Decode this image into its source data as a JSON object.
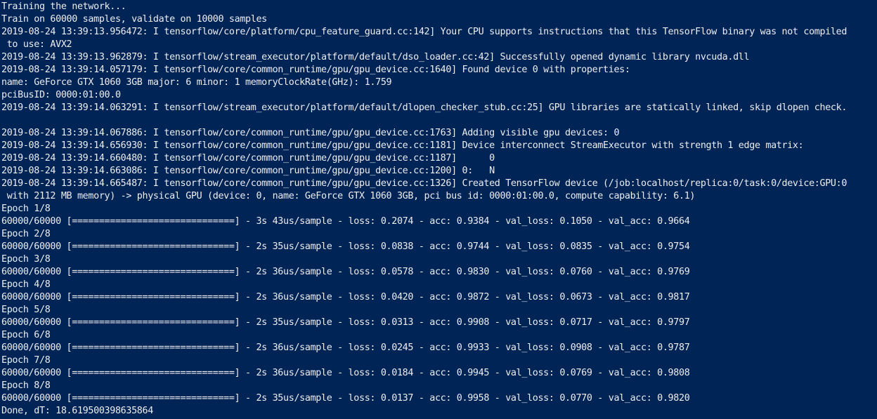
{
  "console": {
    "background_color": "#012456",
    "text_color": "#eeedf0",
    "lines": [
      "Training the network...",
      "Train on 60000 samples, validate on 10000 samples",
      "2019-08-24 13:39:13.956472: I tensorflow/core/platform/cpu_feature_guard.cc:142] Your CPU supports instructions that this TensorFlow binary was not compiled",
      " to use: AVX2",
      "2019-08-24 13:39:13.962879: I tensorflow/stream_executor/platform/default/dso_loader.cc:42] Successfully opened dynamic library nvcuda.dll",
      "2019-08-24 13:39:14.057179: I tensorflow/core/common_runtime/gpu/gpu_device.cc:1640] Found device 0 with properties:",
      "name: GeForce GTX 1060 3GB major: 6 minor: 1 memoryClockRate(GHz): 1.759",
      "pciBusID: 0000:01:00.0",
      "2019-08-24 13:39:14.063291: I tensorflow/stream_executor/platform/default/dlopen_checker_stub.cc:25] GPU libraries are statically linked, skip dlopen check.",
      "",
      "2019-08-24 13:39:14.067886: I tensorflow/core/common_runtime/gpu/gpu_device.cc:1763] Adding visible gpu devices: 0",
      "2019-08-24 13:39:14.656930: I tensorflow/core/common_runtime/gpu/gpu_device.cc:1181] Device interconnect StreamExecutor with strength 1 edge matrix:",
      "2019-08-24 13:39:14.660480: I tensorflow/core/common_runtime/gpu/gpu_device.cc:1187]      0",
      "2019-08-24 13:39:14.663086: I tensorflow/core/common_runtime/gpu/gpu_device.cc:1200] 0:   N",
      "2019-08-24 13:39:14.665487: I tensorflow/core/common_runtime/gpu/gpu_device.cc:1326] Created TensorFlow device (/job:localhost/replica:0/task:0/device:GPU:0",
      " with 2112 MB memory) -> physical GPU (device: 0, name: GeForce GTX 1060 3GB, pci bus id: 0000:01:00.0, compute capability: 6.1)",
      "Epoch 1/8",
      "60000/60000 [==============================] - 3s 43us/sample - loss: 0.2074 - acc: 0.9384 - val_loss: 0.1050 - val_acc: 0.9664",
      "Epoch 2/8",
      "60000/60000 [==============================] - 2s 35us/sample - loss: 0.0838 - acc: 0.9744 - val_loss: 0.0835 - val_acc: 0.9754",
      "Epoch 3/8",
      "60000/60000 [==============================] - 2s 36us/sample - loss: 0.0578 - acc: 0.9830 - val_loss: 0.0760 - val_acc: 0.9769",
      "Epoch 4/8",
      "60000/60000 [==============================] - 2s 36us/sample - loss: 0.0420 - acc: 0.9872 - val_loss: 0.0673 - val_acc: 0.9817",
      "Epoch 5/8",
      "60000/60000 [==============================] - 2s 35us/sample - loss: 0.0313 - acc: 0.9908 - val_loss: 0.0717 - val_acc: 0.9797",
      "Epoch 6/8",
      "60000/60000 [==============================] - 2s 36us/sample - loss: 0.0245 - acc: 0.9933 - val_loss: 0.0908 - val_acc: 0.9787",
      "Epoch 7/8",
      "60000/60000 [==============================] - 2s 36us/sample - loss: 0.0184 - acc: 0.9945 - val_loss: 0.0769 - val_acc: 0.9808",
      "Epoch 8/8",
      "60000/60000 [==============================] - 2s 35us/sample - loss: 0.0137 - acc: 0.9958 - val_loss: 0.0770 - val_acc: 0.9820",
      "Done, dT: 18.619500398635864"
    ]
  }
}
